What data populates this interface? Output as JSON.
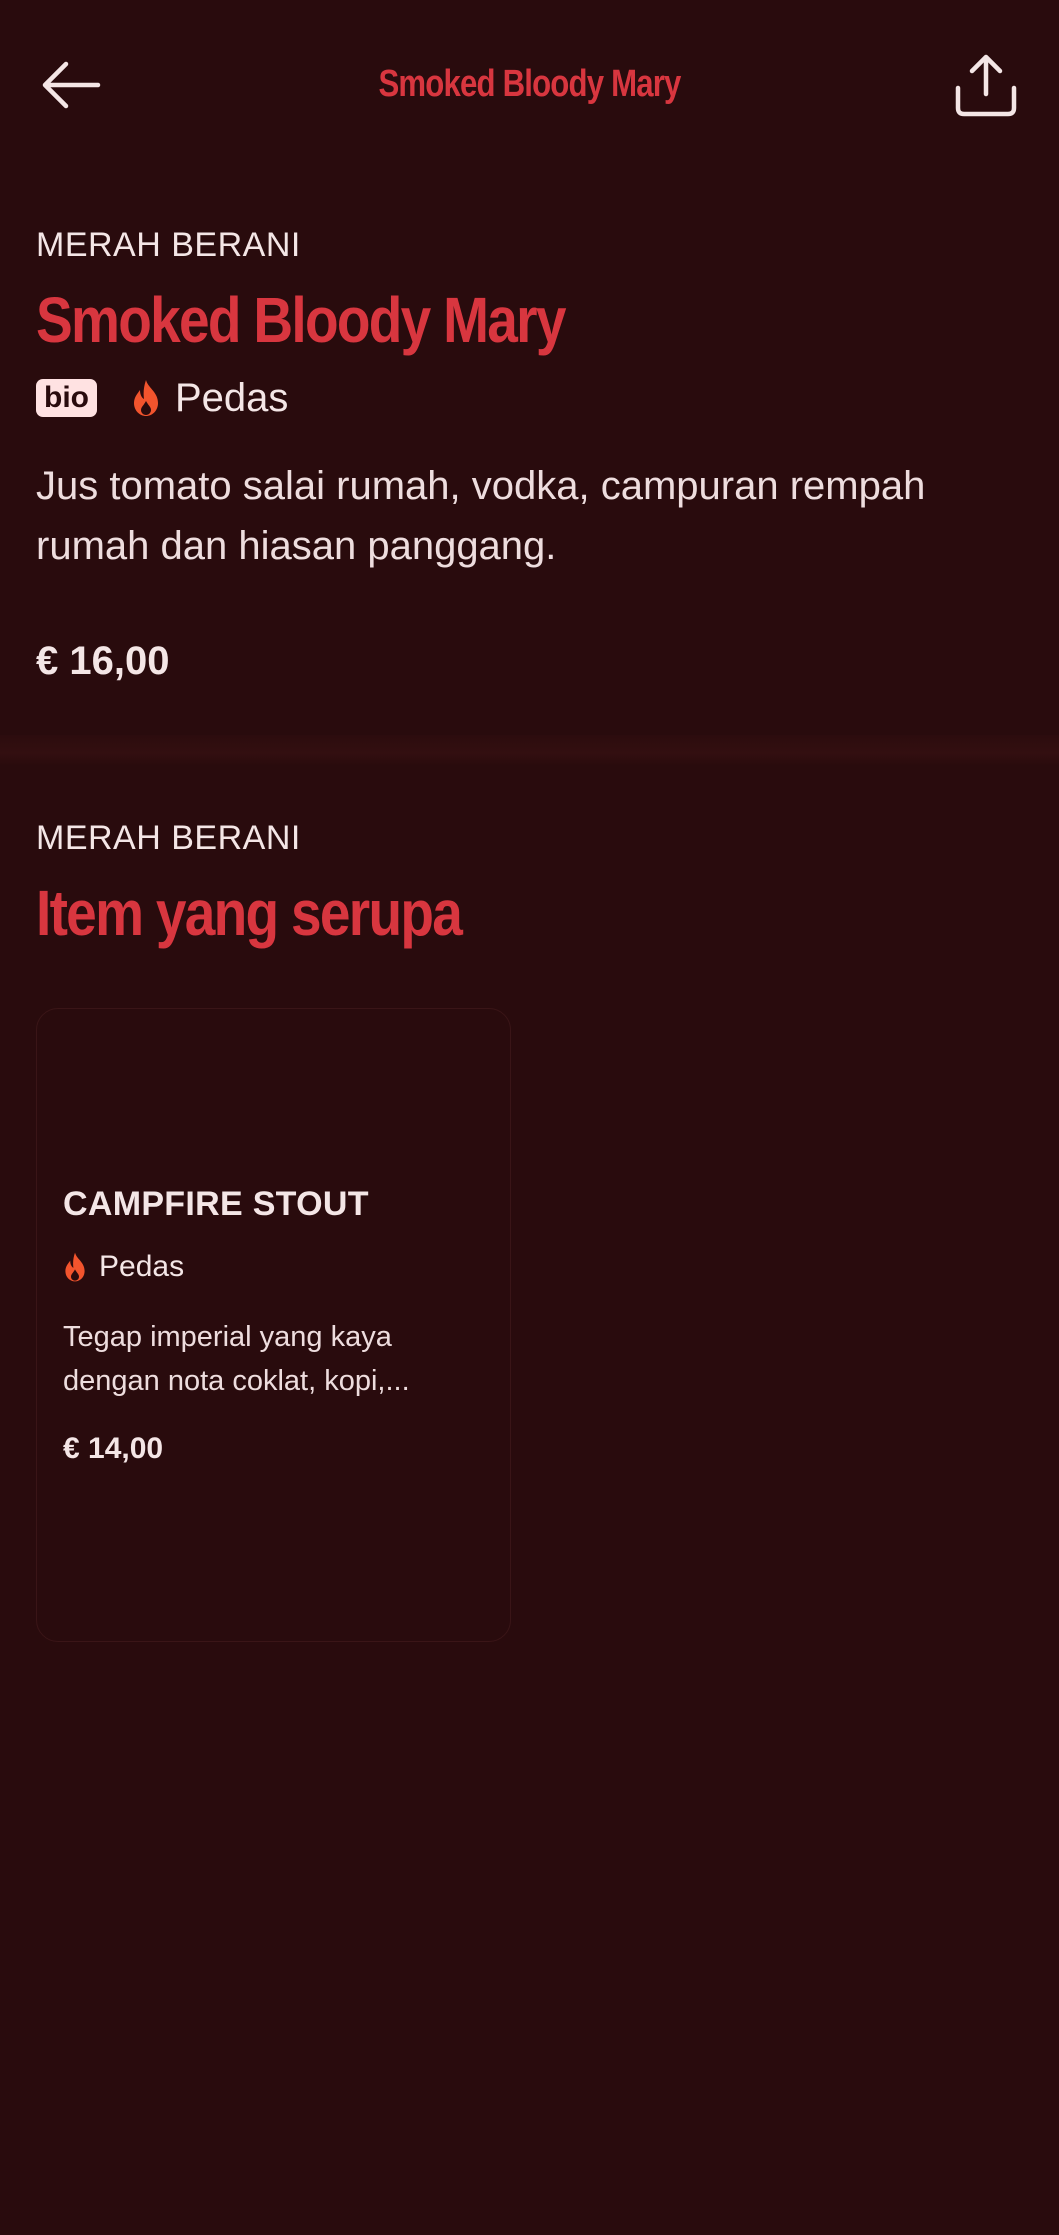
{
  "header": {
    "title": "Smoked Bloody Mary",
    "back_icon": "arrow-left-icon",
    "share_icon": "share-icon"
  },
  "product": {
    "category": "MERAH BERANI",
    "name": "Smoked Bloody Mary",
    "badge": "bio",
    "spice_label": "Pedas",
    "description": "Jus tomato salai rumah, vodka, campuran rempah rumah dan hiasan panggang.",
    "price": "€ 16,00"
  },
  "similar": {
    "category": "MERAH BERANI",
    "title": "Item yang serupa",
    "items": [
      {
        "name": "CAMPFIRE STOUT",
        "spice_label": "Pedas",
        "description": "Tegap imperial yang kaya dengan nota coklat, kopi,...",
        "price": "€ 14,00"
      }
    ]
  },
  "colors": {
    "background": "#290b0d",
    "accent": "#d8363f",
    "flame": "#f2542d",
    "text": "#f4e6e6"
  }
}
